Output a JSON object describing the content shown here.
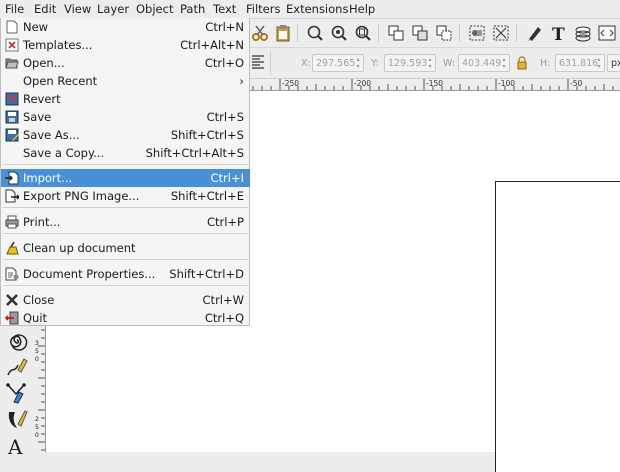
{
  "menubar": [
    "File",
    "Edit",
    "View",
    "Layer",
    "Object",
    "Path",
    "Text",
    "Filters",
    "Extensions",
    "Help"
  ],
  "file_menu": [
    {
      "label": "New",
      "shortcut": "Ctrl+N",
      "icon": "new-document-icon"
    },
    {
      "label": "Templates...",
      "shortcut": "Ctrl+Alt+N",
      "icon": "templates-icon"
    },
    {
      "label": "Open...",
      "shortcut": "Ctrl+O",
      "icon": "open-folder-icon"
    },
    {
      "label": "Open Recent",
      "shortcut": "›",
      "icon": ""
    },
    {
      "label": "Revert",
      "shortcut": "",
      "icon": "revert-icon"
    },
    {
      "label": "Save",
      "shortcut": "Ctrl+S",
      "icon": "save-icon"
    },
    {
      "label": "Save As...",
      "shortcut": "Shift+Ctrl+S",
      "icon": "save-as-icon"
    },
    {
      "label": "Save a Copy...",
      "shortcut": "Shift+Ctrl+Alt+S",
      "icon": ""
    },
    {
      "label": "Import...",
      "shortcut": "Ctrl+I",
      "icon": "import-icon",
      "highlighted": true
    },
    {
      "label": "Export PNG Image...",
      "shortcut": "Shift+Ctrl+E",
      "icon": "export-png-icon"
    },
    {
      "label": "Print...",
      "shortcut": "Ctrl+P",
      "icon": "print-icon"
    },
    {
      "label": "Clean up document",
      "shortcut": "",
      "icon": "clean-up-icon"
    },
    {
      "label": "Document Properties...",
      "shortcut": "Shift+Ctrl+D",
      "icon": "document-properties-icon"
    },
    {
      "label": "Close",
      "shortcut": "Ctrl+W",
      "icon": "close-icon"
    },
    {
      "label": "Quit",
      "shortcut": "Ctrl+Q",
      "icon": "quit-icon"
    }
  ],
  "controls": {
    "x_label": "X:",
    "x_value": "297.565",
    "y_label": "Y:",
    "y_value": "129.593",
    "w_label": "W:",
    "w_value": "403.449",
    "h_label": "H:",
    "h_value": "631.816",
    "unit": "px"
  },
  "ruler_top": [
    "-250",
    "-200",
    "-150",
    "-100",
    "-50"
  ],
  "ruler_left": [
    "3",
    "5",
    "0",
    "2",
    "5",
    "0",
    "2",
    "5"
  ],
  "colors": {
    "highlight": "#4a90d9",
    "menu_bg": "#f5f5f5",
    "chrome": "#ededed"
  }
}
